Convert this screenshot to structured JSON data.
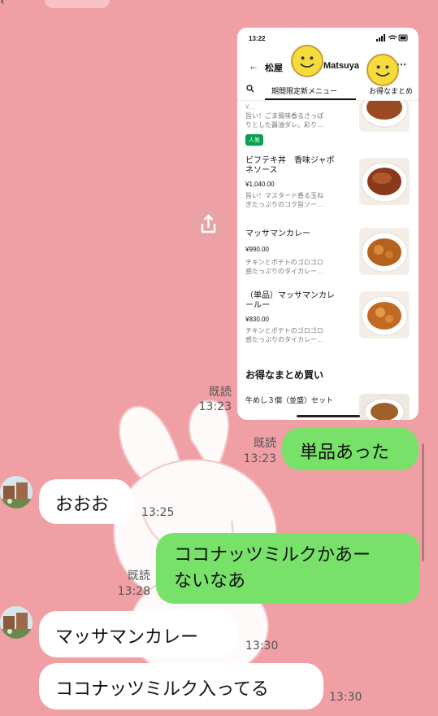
{
  "chat": {
    "messages": [
      {
        "side": "right",
        "type": "image",
        "read": "既読",
        "time": "13:23"
      },
      {
        "side": "right",
        "type": "text",
        "text": "単品あった",
        "read": "既読",
        "time": "13:23"
      },
      {
        "side": "left",
        "type": "text",
        "text": "おおお",
        "time": "13:25"
      },
      {
        "side": "right",
        "type": "text",
        "line1": "ココナッツミルクかあー",
        "line2": "ないなあ",
        "read": "既読",
        "time": "13:28"
      },
      {
        "side": "left",
        "type": "text",
        "text": "マッサマンカレー",
        "time": "13:30"
      },
      {
        "side": "left",
        "type": "text",
        "text": "ココナッツミルク入ってる",
        "time": "13:30"
      }
    ]
  },
  "screenshot": {
    "status_time": "13:22",
    "nav_title_left": "松屋",
    "nav_title_right": "Matsuya",
    "tabs": [
      "期間限定新メニュー",
      "お得なまとめ"
    ],
    "items": [
      {
        "title": "",
        "price": "",
        "desc_line1": "旨い！ごま風味香るさっぱ",
        "desc_line2": "りとした醤油ダレ。彩り…",
        "badge": "人気"
      },
      {
        "title_line1": "ビフテキ丼　香味ジャポ",
        "title_line2": "ネソース",
        "price": "¥1,040.00",
        "desc_line1": "旨い！マスタード香る玉ね",
        "desc_line2": "ぎたっぷりのコク旨ソー…"
      },
      {
        "title_line1": "マッサマンカレー",
        "title_line2": "",
        "price": "¥990.00",
        "desc_line1": "チキンとポテトのゴロゴロ",
        "desc_line2": "感たっぷりのタイカレー…"
      },
      {
        "title_line1": "（単品）マッサマンカレ",
        "title_line2": "ールー",
        "price": "¥830.00",
        "desc_line1": "チキンとポテトのゴロゴロ",
        "desc_line2": "感たっぷりのタイカレー…"
      }
    ],
    "section_title": "お得なまとめ買い",
    "last_item_title": "牛めし３個（並盛）セット"
  },
  "colors": {
    "background": "#f0a0a4",
    "green_bubble": "#78e16a",
    "white_bubble": "#ffffff",
    "badge": "#06a050"
  },
  "icons": [
    "back-arrow-icon",
    "search-icon",
    "share-icon",
    "smiley-icon",
    "more-icon"
  ]
}
